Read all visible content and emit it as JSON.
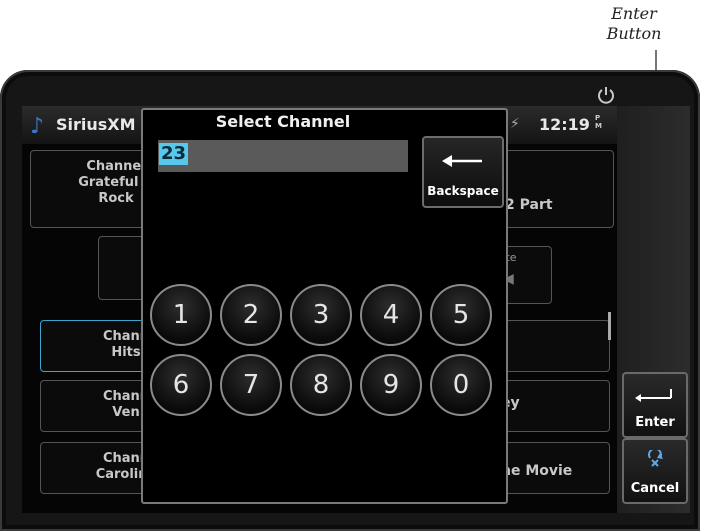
{
  "callout": {
    "line1": "Enter",
    "line2": "Button"
  },
  "status_bar": {
    "app_title": "SiriusXM",
    "time": "12:19",
    "time_suffix_top": "P",
    "time_suffix_bottom": "M"
  },
  "background": {
    "channel_info": {
      "line1": "Channel",
      "line2": "Grateful D",
      "line3": "Rock"
    },
    "part_label": "2 Part",
    "mute_label": "Mute",
    "list_left": [
      {
        "line1": "Chann",
        "line2": "Hits"
      },
      {
        "line1": "Chann",
        "line2": "Ven"
      },
      {
        "line1": "Chann",
        "line2": "Carolina"
      }
    ],
    "list_right": [
      "",
      "ey",
      "he Movie"
    ]
  },
  "dialog": {
    "title": "Select Channel",
    "channel_value": "23",
    "backspace_label": "Backspace",
    "keys": [
      "1",
      "2",
      "3",
      "4",
      "5",
      "6",
      "7",
      "8",
      "9",
      "0"
    ]
  },
  "side_buttons": {
    "enter_label": "Enter",
    "cancel_label": "Cancel"
  },
  "colors": {
    "accent": "#57c7ec",
    "music_icon": "#3a78c8"
  }
}
